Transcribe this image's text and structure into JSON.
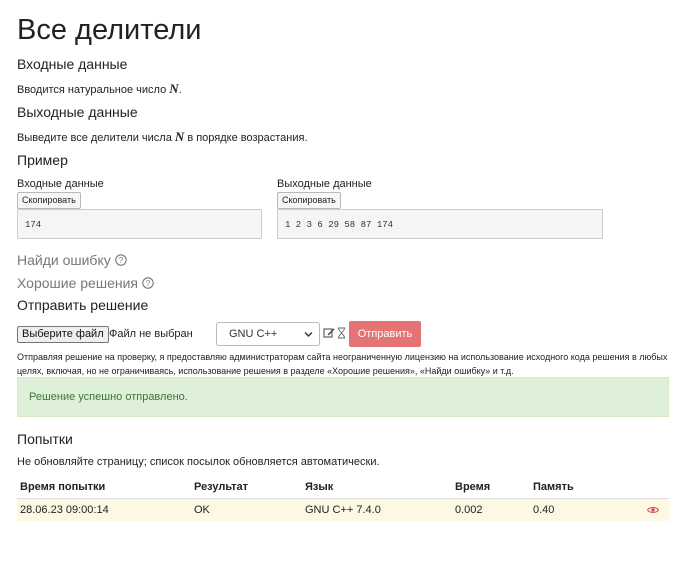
{
  "problem": {
    "title": "Все делители",
    "input_heading": "Входные данные",
    "input_text_before": "Вводится натуральное число ",
    "input_var": "N",
    "input_text_after": ".",
    "output_heading": "Выходные данные",
    "output_text_before": "Выведите все делители числа ",
    "output_var": "N",
    "output_text_after": " в порядке возрастания.",
    "example_heading": "Пример"
  },
  "example": {
    "input_label": "Входные данные",
    "output_label": "Выходные данные",
    "copy_label": "Скопировать",
    "input_value": "174",
    "output_value": "1 2 3 6 29 58 87 174"
  },
  "sections": {
    "find_error": "Найди ошибку",
    "good_solutions": "Хорошие решения",
    "submit_heading": "Отправить решение"
  },
  "submit": {
    "file_button": "Выберите файл",
    "file_status": "Файл не выбран",
    "language_selected": "GNU C++",
    "submit_button": "Отправить",
    "license_line1": "Отправляя решение на проверку, я предоставляю администраторам сайта неограниченную лицензию на использование исходного кода решения в любых",
    "license_line2": "целях, включая, но не ограничиваясь, использование решения в разделе «Хорошие решения», «Найди ошибку» и т.д.",
    "success_message": "Решение успешно отправлено."
  },
  "attempts": {
    "heading": "Попытки",
    "note": "Не обновляйте страницу; список посылок обновляется автоматически.",
    "columns": [
      "Время попытки",
      "Результат",
      "Язык",
      "Время",
      "Память"
    ],
    "rows": [
      {
        "time": "28.06.23 09:00:14",
        "result": "OK",
        "language": "GNU C++ 7.4.0",
        "runtime": "0.002",
        "memory": "0.40"
      }
    ]
  },
  "colors": {
    "submit_button": "#e57373",
    "success_bg": "#dff0d8",
    "success_text": "#3c763d",
    "row_highlight": "#fdf8e3",
    "eye_icon": "#d9534f"
  },
  "icons": [
    "help-circle-icon",
    "edit-icon",
    "hourglass-icon",
    "eye-icon",
    "chevron-down-icon"
  ]
}
